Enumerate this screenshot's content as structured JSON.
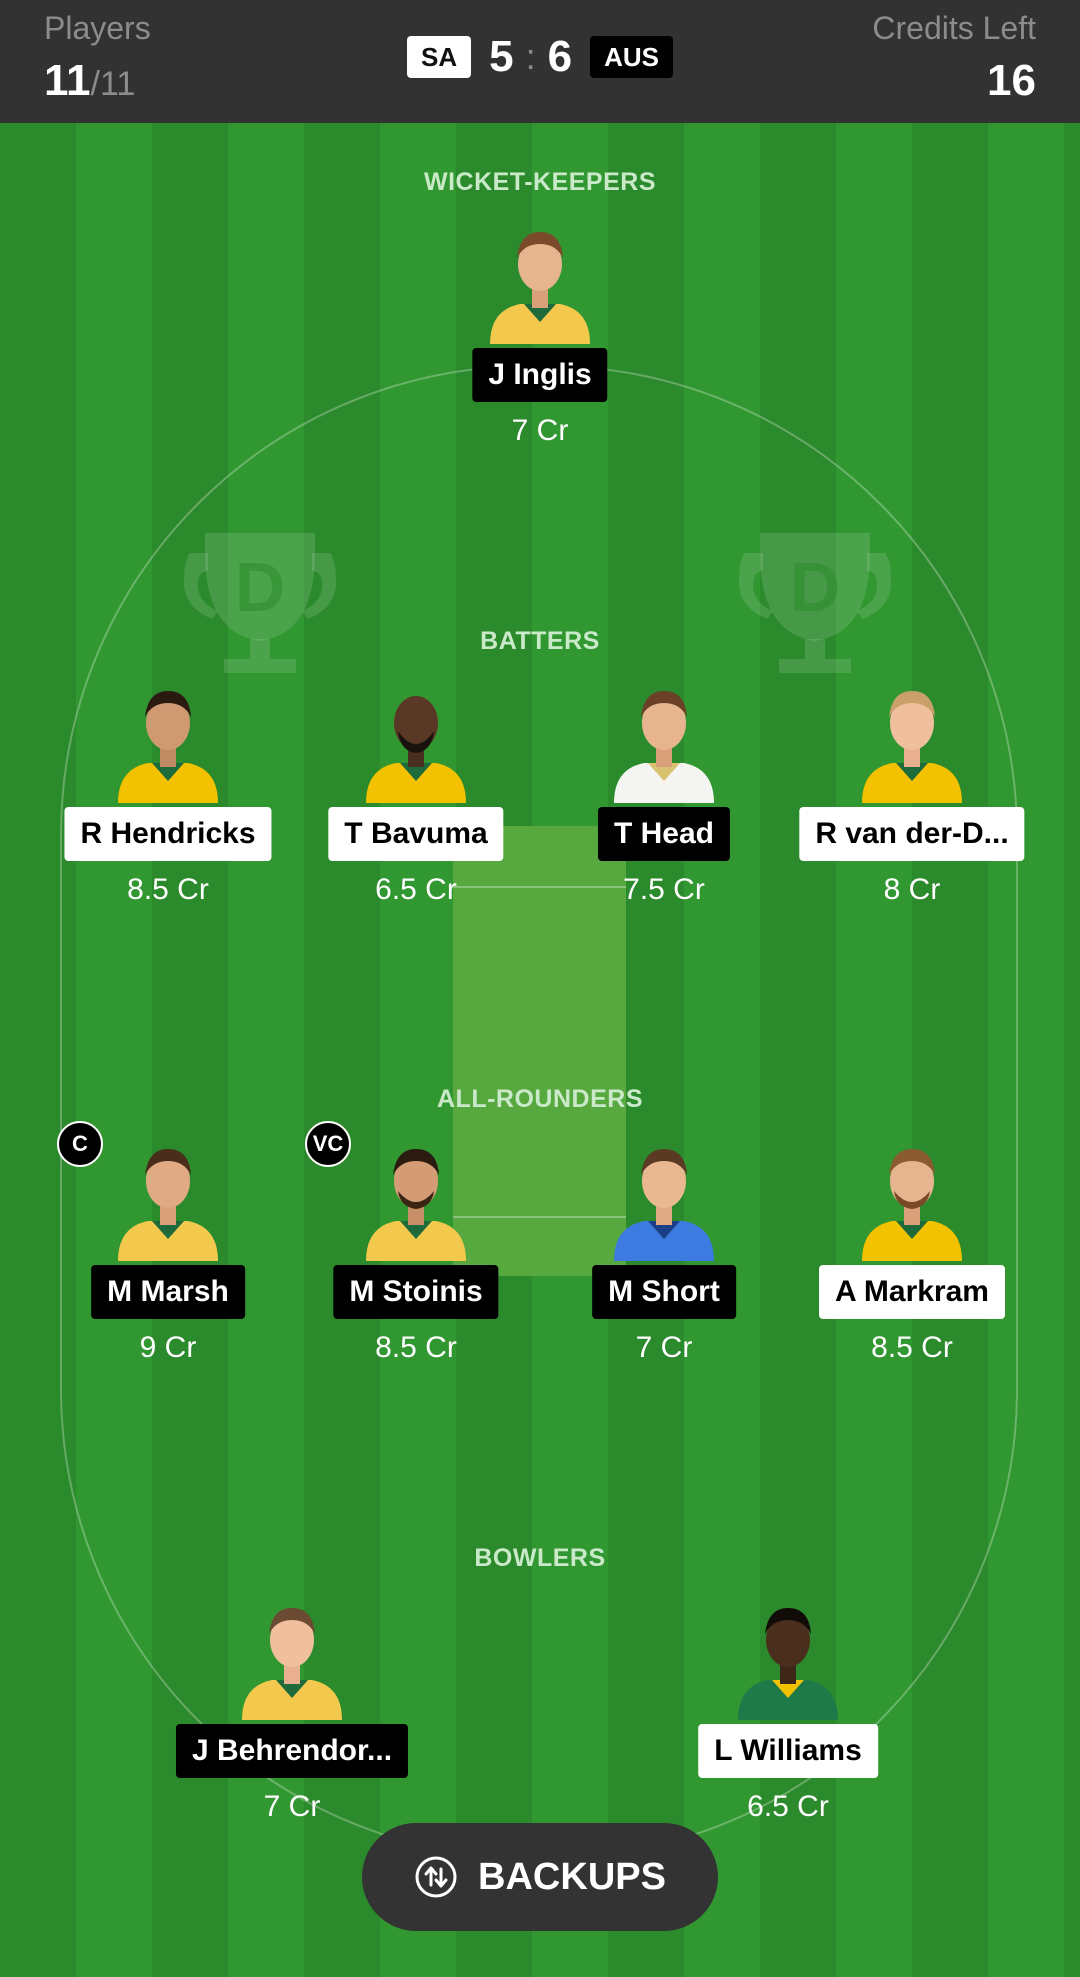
{
  "header": {
    "players_label": "Players",
    "players_count": "11",
    "players_total": "/11",
    "credits_label": "Credits Left",
    "credits_value": "16",
    "team_left": "SA",
    "score_left": "5",
    "score_sep": ":",
    "score_right": "6",
    "team_right": "AUS"
  },
  "sections": {
    "wicket_keepers": "WICKET-KEEPERS",
    "batters": "BATTERS",
    "all_rounders": "ALL-ROUNDERS",
    "bowlers": "BOWLERS"
  },
  "players": {
    "wk": [
      {
        "name": "J Inglis",
        "credits": "7 Cr",
        "team": "AUS"
      }
    ],
    "bat": [
      {
        "name": "R Hendricks",
        "credits": "8.5 Cr",
        "team": "SA"
      },
      {
        "name": "T Bavuma",
        "credits": "6.5 Cr",
        "team": "SA"
      },
      {
        "name": "T Head",
        "credits": "7.5 Cr",
        "team": "AUS"
      },
      {
        "name": "R van der-D...",
        "credits": "8 Cr",
        "team": "SA"
      }
    ],
    "ar": [
      {
        "name": "M Marsh",
        "credits": "9 Cr",
        "team": "AUS",
        "badge": "C"
      },
      {
        "name": "M Stoinis",
        "credits": "8.5 Cr",
        "team": "AUS",
        "badge": "VC"
      },
      {
        "name": "M Short",
        "credits": "7 Cr",
        "team": "AUS"
      },
      {
        "name": "A Markram",
        "credits": "8.5 Cr",
        "team": "SA"
      }
    ],
    "bowl": [
      {
        "name": "J Behrendor...",
        "credits": "7 Cr",
        "team": "AUS"
      },
      {
        "name": "L Williams",
        "credits": "6.5 Cr",
        "team": "SA"
      }
    ]
  },
  "backups_label": "BACKUPS",
  "colors": {
    "field_dark": "#2b8a2b",
    "field_light": "#319731",
    "pitch": "#57a83f",
    "topbar": "#323232",
    "sa_jersey": "#f2c200",
    "aus_jersey": "#f2c94c",
    "short_jersey": "#3d7be0"
  }
}
